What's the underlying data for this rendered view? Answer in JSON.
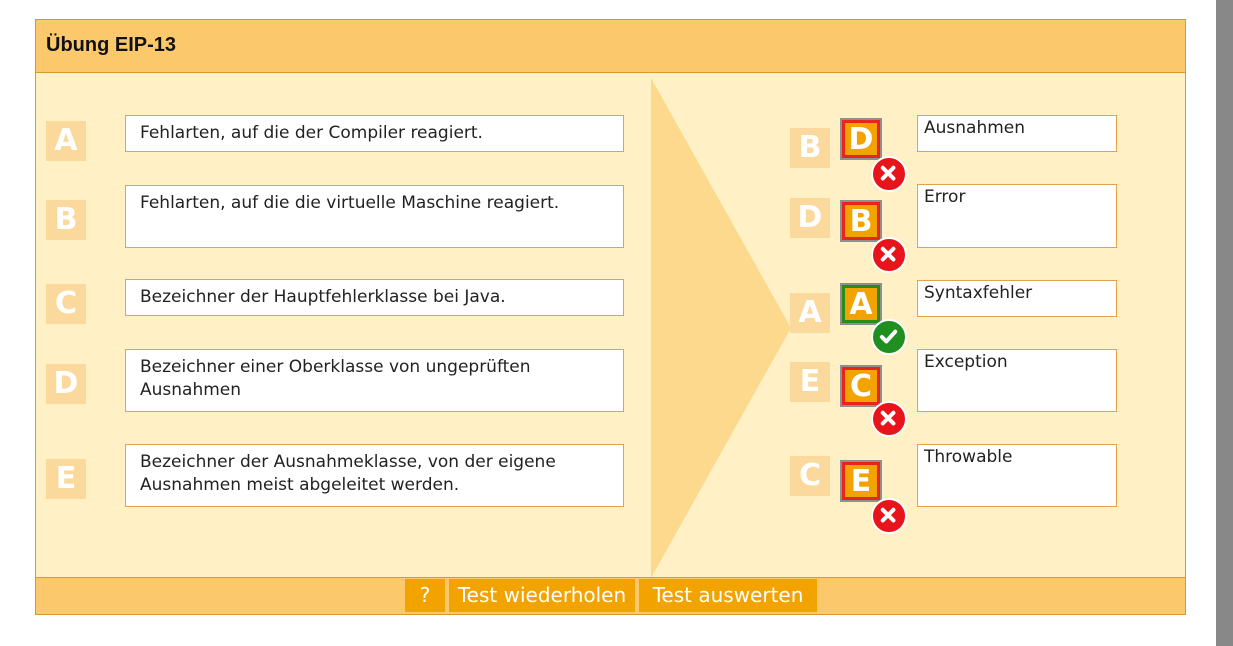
{
  "window": {
    "title": "Übung EIP-13"
  },
  "statements": [
    {
      "letter": "A",
      "text": "Fehlarten, auf die der Compiler reagiert."
    },
    {
      "letter": "B",
      "text": "Fehlarten, auf die die virtuelle Maschine reagiert."
    },
    {
      "letter": "C",
      "text": "Bezeichner der Hauptfehlerklasse bei Java."
    },
    {
      "letter": "D",
      "text": "Bezeichner einer Oberklasse von ungeprüften Ausnahmen"
    },
    {
      "letter": "E",
      "text": "Bezeichner der Ausnahmeklasse, von der eigene Ausnahmen meist abgeleitet werden."
    }
  ],
  "answers": [
    {
      "correct_letter": "B",
      "chosen_letter": "D",
      "status": "wrong",
      "label": "Ausnahmen"
    },
    {
      "correct_letter": "D",
      "chosen_letter": "B",
      "status": "wrong",
      "label": "Error"
    },
    {
      "correct_letter": "A",
      "chosen_letter": "A",
      "status": "correct",
      "label": "Syntaxfehler"
    },
    {
      "correct_letter": "E",
      "chosen_letter": "C",
      "status": "wrong",
      "label": "Exception"
    },
    {
      "correct_letter": "C",
      "chosen_letter": "E",
      "status": "wrong",
      "label": "Throwable"
    }
  ],
  "footer": {
    "help_label": "?",
    "repeat_label": "Test wiederholen",
    "evaluate_label": "Test auswerten"
  },
  "colors": {
    "panel_bg": "#fff0c5",
    "header_bg": "#fbc96c",
    "accent_orange": "#f2a300",
    "letter_box": "#fbd99c",
    "wrong_red": "#e8141c",
    "correct_green": "#1f8f1f"
  },
  "icons": {
    "wrong": "x-circle-icon",
    "correct": "check-circle-icon"
  }
}
